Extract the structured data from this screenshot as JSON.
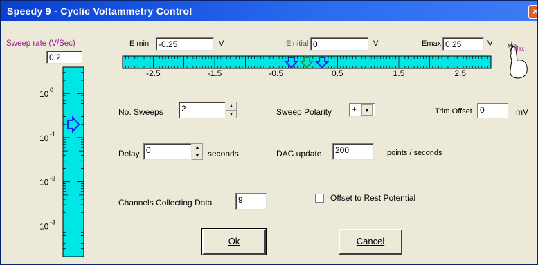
{
  "window": {
    "title": "Speedy 9 - Cyclic Voltammetry Control",
    "close_symbol": "×"
  },
  "sweep_rate": {
    "label": "Sweep rate (V/Sec)",
    "value": "0.2",
    "scale_ticks": [
      {
        "base": "10",
        "exp": "0"
      },
      {
        "base": "10",
        "exp": "-1"
      },
      {
        "base": "10",
        "exp": "-2"
      },
      {
        "base": "10",
        "exp": "-3"
      }
    ],
    "slider_position_log10": -0.7,
    "color": "#00e5e5"
  },
  "potentials": {
    "emin_label": "E min",
    "emin_value": "-0.25",
    "emin_unit": "V",
    "einitial_label": "Einitial",
    "einitial_value": "0",
    "einitial_unit": "V",
    "emax_label": "Emax",
    "emax_value": "0.25",
    "emax_unit": "V",
    "axis_labels": [
      "-2.5",
      "-1.5",
      "-0.5",
      "0.5",
      "1.5",
      "2.5"
    ],
    "axis_range": [
      -3.0,
      3.0
    ],
    "marker_emin": -0.25,
    "marker_einitial": 0,
    "marker_emax": 0.25,
    "knob_label_min": "Min",
    "knob_label_max": "Max",
    "bar_color": "#00e5e5"
  },
  "sweeps": {
    "label": "No. Sweeps",
    "value": "2"
  },
  "polarity": {
    "label": "Sweep Polarity",
    "value": "+"
  },
  "trim": {
    "label": "Trim Offset",
    "value": "0",
    "unit": "mV"
  },
  "delay": {
    "label": "Delay",
    "value": "0",
    "unit": "seconds"
  },
  "dac": {
    "label": "DAC update",
    "value": "200",
    "unit": "points / seconds"
  },
  "channels": {
    "label": "Channels Collecting Data",
    "value": "9"
  },
  "rest_offset": {
    "label": "Offset to Rest Potential",
    "checked": false
  },
  "buttons": {
    "ok": "Ok",
    "cancel": "Cancel"
  }
}
